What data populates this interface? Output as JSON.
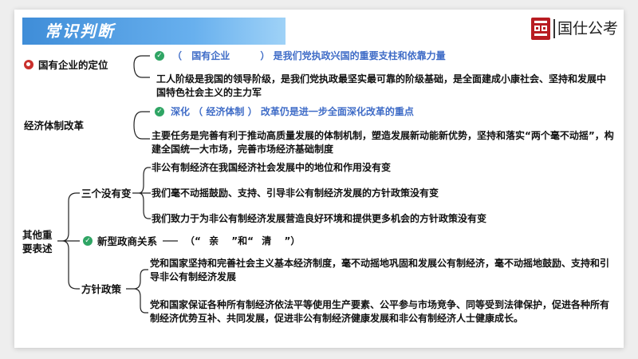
{
  "banner": {
    "title": "常识判断"
  },
  "logo": {
    "text": "国仕公考"
  },
  "sections": {
    "soe": {
      "category": "国有企业的定位",
      "item1": {
        "lp": "（",
        "blank": "国有企业",
        "rp": "）",
        "rest": "是我们党执政兴国的重要支柱和依靠力量"
      },
      "item2": "工人阶级是我国的领导阶级，是我们党执政最坚实最可靠的阶级基础，是全面建成小康社会、坚持和发展中国特色社会主义的主力军"
    },
    "reform": {
      "category": "经济体制改革",
      "item1": {
        "a": "深化",
        "lp": "（",
        "blank": "经济体制",
        "rp": "）",
        "rest": "改革仍是进一步全面深化改革的重点"
      },
      "item2": "主要任务是完善有利于推动高质量发展的体制机制，塑造发展新动能新优势，坚持和落实“两个毫不动摇”，构建全国统一大市场，完善市场经济基础制度"
    },
    "other": {
      "category": "其他重要表述",
      "three": {
        "label": "三个没有变",
        "items": [
          "非公有制经济在我国经济社会发展中的地位和作用没有变",
          "我们毫不动摇鼓励、支持、引导非公有制经济发展的方针政策没有变",
          "我们致力于为非公有制经济发展营造良好环境和提供更多机会的方针政策没有变"
        ]
      },
      "relation": {
        "label": "新型政商关系",
        "dash": "——",
        "p1": "（“",
        "w1": "亲",
        "mid": "”和“",
        "w2": "清",
        "p2": "”）"
      },
      "policy": {
        "label": "方针政策",
        "items": [
          "党和国家坚持和完善社会主义基本经济制度，毫不动摇地巩固和发展公有制经济，毫不动摇地鼓励、支持和引导非公有制经济发展",
          "党和国家保证各种所有制经济依法平等使用生产要素、公平参与市场竞争、同等受到法律保护，促进各种所有制经济优势互补、共同发展，促进非公有制经济健康发展和非公有制经济人士健康成长。"
        ]
      }
    }
  }
}
